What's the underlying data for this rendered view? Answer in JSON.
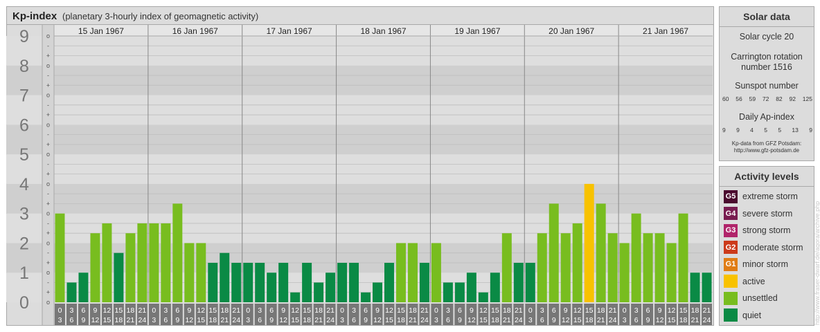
{
  "header": {
    "title": "Kp-index",
    "subtitle": "(planetary 3-hourly index of geomagnetic activity)"
  },
  "chart_data": {
    "type": "bar",
    "title": "Kp-index",
    "subtitle": "(planetary 3-hourly index of geomagnetic activity)",
    "ylim": [
      0,
      9
    ],
    "y_ticks": [
      "0",
      "1",
      "2",
      "3",
      "4",
      "5",
      "6",
      "7",
      "8",
      "9"
    ],
    "minor_ticks": [
      "o",
      "+",
      "-"
    ],
    "days": [
      "15 Jan 1967",
      "16 Jan 1967",
      "17 Jan 1967",
      "18 Jan 1967",
      "19 Jan 1967",
      "20 Jan 1967",
      "21 Jan 1967"
    ],
    "interval_start": [
      "0",
      "3",
      "6",
      "9",
      "12",
      "15",
      "18",
      "21"
    ],
    "interval_end": [
      "3",
      "6",
      "9",
      "12",
      "15",
      "18",
      "21",
      "24"
    ],
    "values": [
      3.0,
      0.667,
      1.0,
      2.333,
      2.667,
      1.667,
      2.333,
      2.667,
      2.667,
      2.667,
      3.333,
      2.0,
      2.0,
      1.333,
      1.667,
      1.333,
      1.333,
      1.333,
      1.0,
      1.333,
      0.333,
      1.333,
      0.667,
      1.0,
      1.333,
      1.333,
      0.333,
      0.667,
      1.333,
      2.0,
      2.0,
      1.333,
      2.0,
      0.667,
      0.667,
      1.0,
      0.333,
      1.0,
      2.333,
      1.333,
      1.333,
      2.333,
      3.333,
      2.333,
      2.667,
      4.0,
      3.333,
      2.333,
      2.0,
      3.0,
      2.333,
      2.333,
      2.0,
      3.0,
      1.0,
      1.0
    ],
    "colors": {
      "quiet": "#0a8a45",
      "unsettled": "#78bd1f",
      "active": "#f8c200"
    },
    "grid": true
  },
  "solar": {
    "title": "Solar data",
    "cycle": "Solar cycle 20",
    "carrington_line1": "Carrington rotation",
    "carrington_line2": "number 1516",
    "sunspot_label": "Sunspot number",
    "sunspot_values": [
      "60",
      "56",
      "59",
      "72",
      "82",
      "92",
      "125"
    ],
    "ap_label": "Daily Ap-index",
    "ap_values": [
      "9",
      "9",
      "4",
      "5",
      "5",
      "13",
      "9"
    ],
    "source_line1": "Kp-data from GFZ Potsdam:",
    "source_line2": "http://www.gfz-potsdam.de"
  },
  "levels": {
    "title": "Activity levels",
    "items": [
      {
        "code": "G5",
        "label": "extreme storm",
        "color": "#4a0a2e"
      },
      {
        "code": "G4",
        "label": "severe storm",
        "color": "#781c50"
      },
      {
        "code": "G3",
        "label": "strong storm",
        "color": "#b0246a"
      },
      {
        "code": "G2",
        "label": "moderate storm",
        "color": "#cc3a1a"
      },
      {
        "code": "G1",
        "label": "minor storm",
        "color": "#e07d15"
      },
      {
        "code": "",
        "label": "active",
        "color": "#f8c200"
      },
      {
        "code": "",
        "label": "unsettled",
        "color": "#78bd1f"
      },
      {
        "code": "",
        "label": "quiet",
        "color": "#0a8a45"
      }
    ]
  },
  "watermark": "http://www.fraser-dwarf.de/agora/archive.php"
}
